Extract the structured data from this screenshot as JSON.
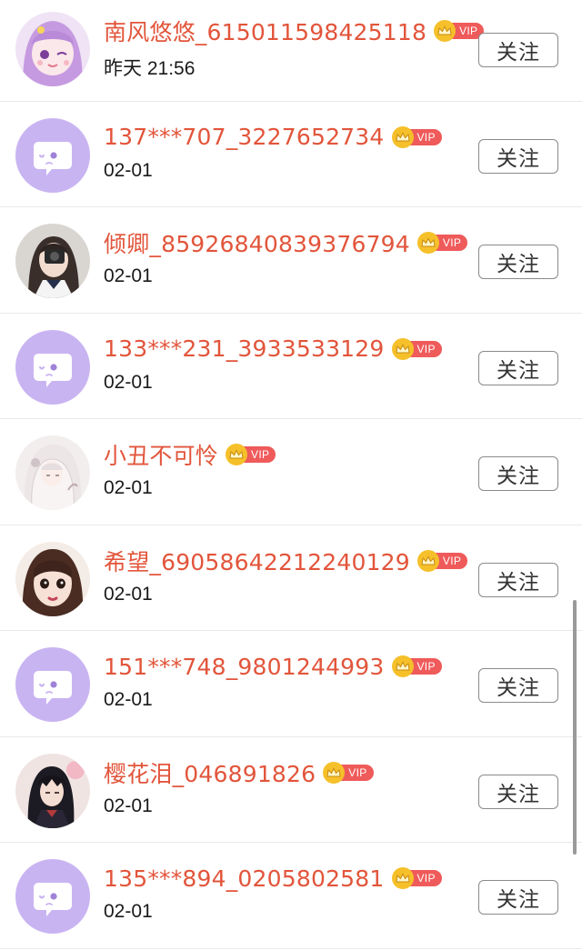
{
  "follow_list": [
    {
      "name": "南风悠悠_615011598425118",
      "vip_label": "VIP",
      "time": "昨天 21:56",
      "follow_label": "关注",
      "avatar": "anime-girl-pink-avatar"
    },
    {
      "name": "137***707_3227652734",
      "vip_label": "VIP",
      "time": "02-01",
      "follow_label": "关注",
      "avatar": "default-chat-bubble-avatar"
    },
    {
      "name": "倾卿_85926840839376794",
      "vip_label": "VIP",
      "time": "02-01",
      "follow_label": "关注",
      "avatar": "girl-photo-avatar"
    },
    {
      "name": "133***231_3933533129",
      "vip_label": "VIP",
      "time": "02-01",
      "follow_label": "关注",
      "avatar": "default-chat-bubble-avatar"
    },
    {
      "name": "小丑不可怜",
      "vip_label": "VIP",
      "time": "02-01",
      "follow_label": "关注",
      "avatar": "anime-white-hair-avatar"
    },
    {
      "name": "希望_69058642212240129",
      "vip_label": "VIP",
      "time": "02-01",
      "follow_label": "关注",
      "avatar": "doll-face-avatar"
    },
    {
      "name": "151***748_9801244993",
      "vip_label": "VIP",
      "time": "02-01",
      "follow_label": "关注",
      "avatar": "default-chat-bubble-avatar"
    },
    {
      "name": "樱花泪_046891826",
      "vip_label": "VIP",
      "time": "02-01",
      "follow_label": "关注",
      "avatar": "anime-boy-avatar"
    },
    {
      "name": "135***894_0205802581",
      "vip_label": "VIP",
      "time": "02-01",
      "follow_label": "关注",
      "avatar": "default-chat-bubble-avatar"
    }
  ],
  "colors": {
    "name": "#e2553b",
    "vip_crown": "#f5c02a",
    "vip_tag": "#ef5a5a",
    "default_avatar_bg": "#c9b4f2",
    "button_border": "#8a8a8a"
  }
}
